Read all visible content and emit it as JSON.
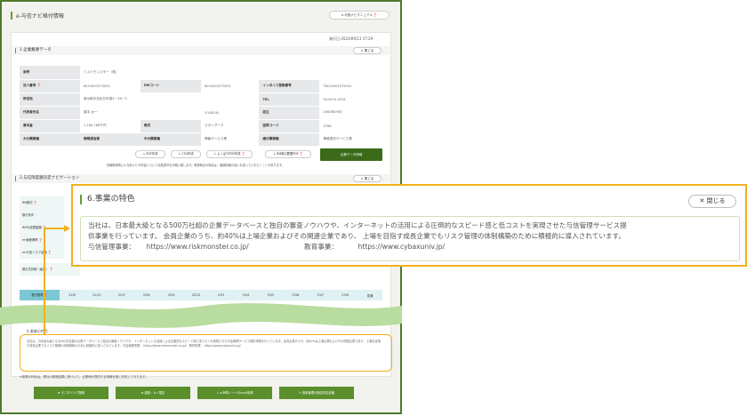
{
  "header": {
    "title": "e-与信ナビ格付情報",
    "manual_label": "e-与信ナビマニュアル ❓"
  },
  "issued": "発行日 2023/09/13 17:29",
  "section1": {
    "title": "1.企業概要データ",
    "close": "× 閉じる"
  },
  "company_table": [
    [
      [
        "商号",
        "h"
      ],
      [
        "リスクモンスター（株）",
        "v"
      ]
    ],
    [
      [
        "法人番号 ❓",
        "h"
      ],
      [
        "6010001075031",
        "v"
      ],
      [
        "RMコード",
        "h"
      ],
      [
        "6010001075031",
        "v"
      ],
      [
        "インボイス登録番号",
        "h"
      ],
      [
        "T6010001075031",
        "v"
      ]
    ],
    [
      [
        "所在地",
        "h"
      ],
      [
        "東京都中央区日本橋2－16－5",
        "v"
      ],
      [
        "",
        "v"
      ],
      [
        "",
        "v"
      ],
      [
        "TEL",
        "h"
      ],
      [
        "03-6214-0331",
        "v"
      ]
    ],
    [
      [
        "代表者氏名",
        "h"
      ],
      [
        "藤本 太一",
        "v"
      ],
      [
        "",
        "v"
      ],
      [
        "3-VISION",
        "v"
      ],
      [
        "設立",
        "h"
      ],
      [
        "2000年09月",
        "v"
      ]
    ],
    [
      [
        "資本金",
        "h"
      ],
      [
        "1,160,768千円",
        "v"
      ],
      [
        "株式",
        "h"
      ],
      [
        "スタンダード",
        "v"
      ],
      [
        "証券コード",
        "h"
      ],
      [
        "3768",
        "v"
      ]
    ],
    [
      [
        "大分類業種",
        "h"
      ],
      [
        "情報通信業",
        "h"
      ],
      [
        "中分類業種",
        "h"
      ],
      [
        "情報サービス業",
        "v"
      ],
      [
        "細分類業種",
        "h"
      ],
      [
        "情報提供サービス業",
        "v"
      ]
    ]
  ],
  "small_buttons": [
    "↓ PDF作成",
    "↓ CSV作成",
    "↓ よくばりPDF作成 ❓",
    "↓ RM取引履歴PDF ❓"
  ],
  "detail_button": "企業データ詳細",
  "note": "情報取得時にe-与信ナビの内容について社是認可をお願い致します。取得時点の場合は、価値情報の違いを書いていただくことがあります。",
  "section2": {
    "title": "2.与信限度額決定ナビゲーション",
    "close": "× 閉じる"
  },
  "nav_labels": [
    "RM格付 ❓",
    "取引条件",
    "RM与信限度額 ❓",
    "rm倒産確率 ❓",
    "rm与信リスク金額 ❓",
    "取引先詳細（最新） ❓"
  ],
  "period": {
    "label": "格付推移 ❓",
    "cols": [
      "21/8",
      "21/12",
      "22/3",
      "22/6",
      "22/9",
      "22/12",
      "23/3",
      "23/4",
      "23/5",
      "23/6",
      "23/7",
      "23/8",
      "見通"
    ]
  },
  "section6_small": "6.事業の特色",
  "small_body": "当社は、日本最大級となる500万社超の企業データベースと独自の審査ノウハウや、インターネットの活用による圧倒的なスピード感と低コストを実現させた与信管理サービス提供事業を行っています。会員企業のうち、約40%は上場企業およびその関連企業であり、上場を目指す成長企業でもリスク管理の体制構築のために積極的に導入されています。与信管理事業： https://www.riskmonster.co.jp/　教育事業： https://www.cybaxuniv.jp/",
  "footnote": "※事業の特色は、弊社の調査結果に基づいて、企業側が提供する情報を基に作成しております。",
  "bottom_buttons": [
    "⊕ モニタリング登録",
    "⊕ 調査・キノ限定",
    "↓ e-声明ノート(Excel)取得",
    "✎ 信用管理の適否判定依頼"
  ],
  "popup": {
    "title": "6.事業の特色",
    "close": "✕ 閉じる",
    "line1": "当社は、日本最大級となる500万社超の企業データベースと独自の審査ノウハウや、インターネットの活用による圧倒的なスピード感と低コストを実現させた与信管理サービス提",
    "line2": "供事業を行っています。 会員企業のうち、約40%は上場企業およびその関連企業であり、 上場を目指す成長企業でもリスク管理の体制構築のために積極的に導入されています。",
    "label1": "与信管理事業：",
    "url1": "https://www.riskmonster.co.jp/",
    "label2": "教育事業：",
    "url2": "https://www.cybaxuniv.jp/"
  },
  "colors": {
    "accent_orange": "#f2b01e",
    "frame_green": "#4e7a2c",
    "button_green": "#5a8f2c"
  }
}
